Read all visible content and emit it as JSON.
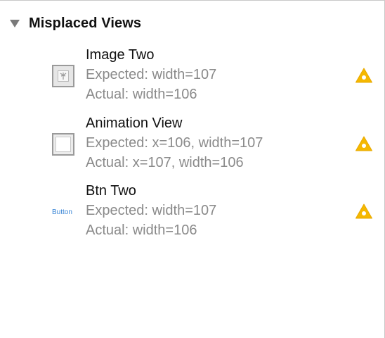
{
  "section": {
    "title": "Misplaced Views"
  },
  "issues": [
    {
      "name": "Image Two",
      "expected": "Expected: width=107",
      "actual": "Actual: width=106",
      "thumbnail_icon": "image-view-icon"
    },
    {
      "name": "Animation View",
      "expected": "Expected: x=106, width=107",
      "actual": "Actual: x=107, width=106",
      "thumbnail_icon": "view-icon"
    },
    {
      "name": "Btn Two",
      "expected": "Expected: width=107",
      "actual": "Actual: width=106",
      "thumbnail_label": "Button"
    }
  ],
  "colors": {
    "warning": "#f5b800",
    "button_text": "#3a86d6"
  }
}
